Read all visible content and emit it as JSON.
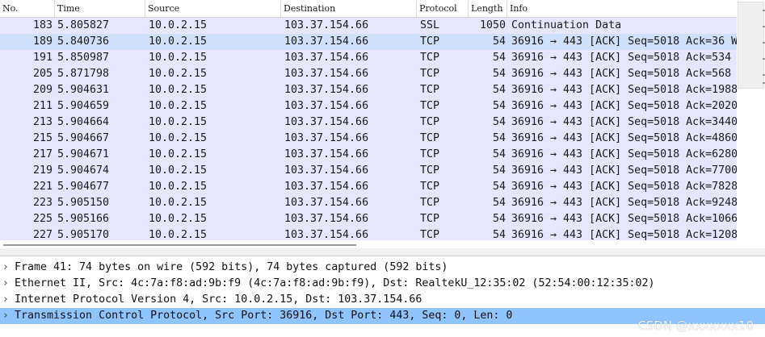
{
  "packet_list": {
    "headers": {
      "no": "No.",
      "time": "Time",
      "source": "Source",
      "destination": "Destination",
      "protocol": "Protocol",
      "length": "Length",
      "info": "Info"
    },
    "rows": [
      {
        "no": "183",
        "time": "5.805827",
        "source": "10.0.2.15",
        "destination": "103.37.154.66",
        "protocol": "SSL",
        "length": "1050",
        "info": "Continuation Data"
      },
      {
        "no": "189",
        "time": "5.840736",
        "source": "10.0.2.15",
        "destination": "103.37.154.66",
        "protocol": "TCP",
        "length": "54",
        "info": "36916 → 443 [ACK] Seq=5018 Ack=36 W"
      },
      {
        "no": "191",
        "time": "5.850987",
        "source": "10.0.2.15",
        "destination": "103.37.154.66",
        "protocol": "TCP",
        "length": "54",
        "info": "36916 → 443 [ACK] Seq=5018 Ack=534"
      },
      {
        "no": "205",
        "time": "5.871798",
        "source": "10.0.2.15",
        "destination": "103.37.154.66",
        "protocol": "TCP",
        "length": "54",
        "info": "36916 → 443 [ACK] Seq=5018 Ack=568"
      },
      {
        "no": "209",
        "time": "5.904631",
        "source": "10.0.2.15",
        "destination": "103.37.154.66",
        "protocol": "TCP",
        "length": "54",
        "info": "36916 → 443 [ACK] Seq=5018 Ack=1988"
      },
      {
        "no": "211",
        "time": "5.904659",
        "source": "10.0.2.15",
        "destination": "103.37.154.66",
        "protocol": "TCP",
        "length": "54",
        "info": "36916 → 443 [ACK] Seq=5018 Ack=2020"
      },
      {
        "no": "213",
        "time": "5.904664",
        "source": "10.0.2.15",
        "destination": "103.37.154.66",
        "protocol": "TCP",
        "length": "54",
        "info": "36916 → 443 [ACK] Seq=5018 Ack=3440"
      },
      {
        "no": "215",
        "time": "5.904667",
        "source": "10.0.2.15",
        "destination": "103.37.154.66",
        "protocol": "TCP",
        "length": "54",
        "info": "36916 → 443 [ACK] Seq=5018 Ack=4860"
      },
      {
        "no": "217",
        "time": "5.904671",
        "source": "10.0.2.15",
        "destination": "103.37.154.66",
        "protocol": "TCP",
        "length": "54",
        "info": "36916 → 443 [ACK] Seq=5018 Ack=6280"
      },
      {
        "no": "219",
        "time": "5.904674",
        "source": "10.0.2.15",
        "destination": "103.37.154.66",
        "protocol": "TCP",
        "length": "54",
        "info": "36916 → 443 [ACK] Seq=5018 Ack=7700"
      },
      {
        "no": "221",
        "time": "5.904677",
        "source": "10.0.2.15",
        "destination": "103.37.154.66",
        "protocol": "TCP",
        "length": "54",
        "info": "36916 → 443 [ACK] Seq=5018 Ack=7828"
      },
      {
        "no": "223",
        "time": "5.905150",
        "source": "10.0.2.15",
        "destination": "103.37.154.66",
        "protocol": "TCP",
        "length": "54",
        "info": "36916 → 443 [ACK] Seq=5018 Ack=9248"
      },
      {
        "no": "225",
        "time": "5.905166",
        "source": "10.0.2.15",
        "destination": "103.37.154.66",
        "protocol": "TCP",
        "length": "54",
        "info": "36916 → 443 [ACK] Seq=5018 Ack=1066"
      },
      {
        "no": "227",
        "time": "5.905170",
        "source": "10.0.2.15",
        "destination": "103.37.154.66",
        "protocol": "TCP",
        "length": "54",
        "info": "36916 → 443 [ACK] Seq=5018 Ack=1208"
      }
    ],
    "selected_row": 1,
    "colors": {
      "row_bg": "#e7e6ff",
      "selected_row_bg": "#cfe0fb"
    }
  },
  "details": {
    "items": [
      {
        "chevron": "chevron-right-icon",
        "text": "Frame 41: 74 bytes on wire (592 bits), 74 bytes captured (592 bits)"
      },
      {
        "chevron": "chevron-right-icon",
        "text": "Ethernet II, Src: 4c:7a:f8:ad:9b:f9 (4c:7a:f8:ad:9b:f9), Dst: RealtekU_12:35:02 (52:54:00:12:35:02)"
      },
      {
        "chevron": "chevron-right-icon",
        "text": "Internet Protocol Version 4, Src: 10.0.2.15, Dst: 103.37.154.66"
      },
      {
        "chevron": "chevron-right-icon",
        "text": "Transmission Control Protocol, Src Port: 36916, Dst Port: 443, Seq: 0, Len: 0"
      }
    ],
    "selected_item": 3,
    "colors": {
      "selected_bg": "#8fc4ff"
    }
  },
  "watermark": "CSDN @xxxxxxx10"
}
